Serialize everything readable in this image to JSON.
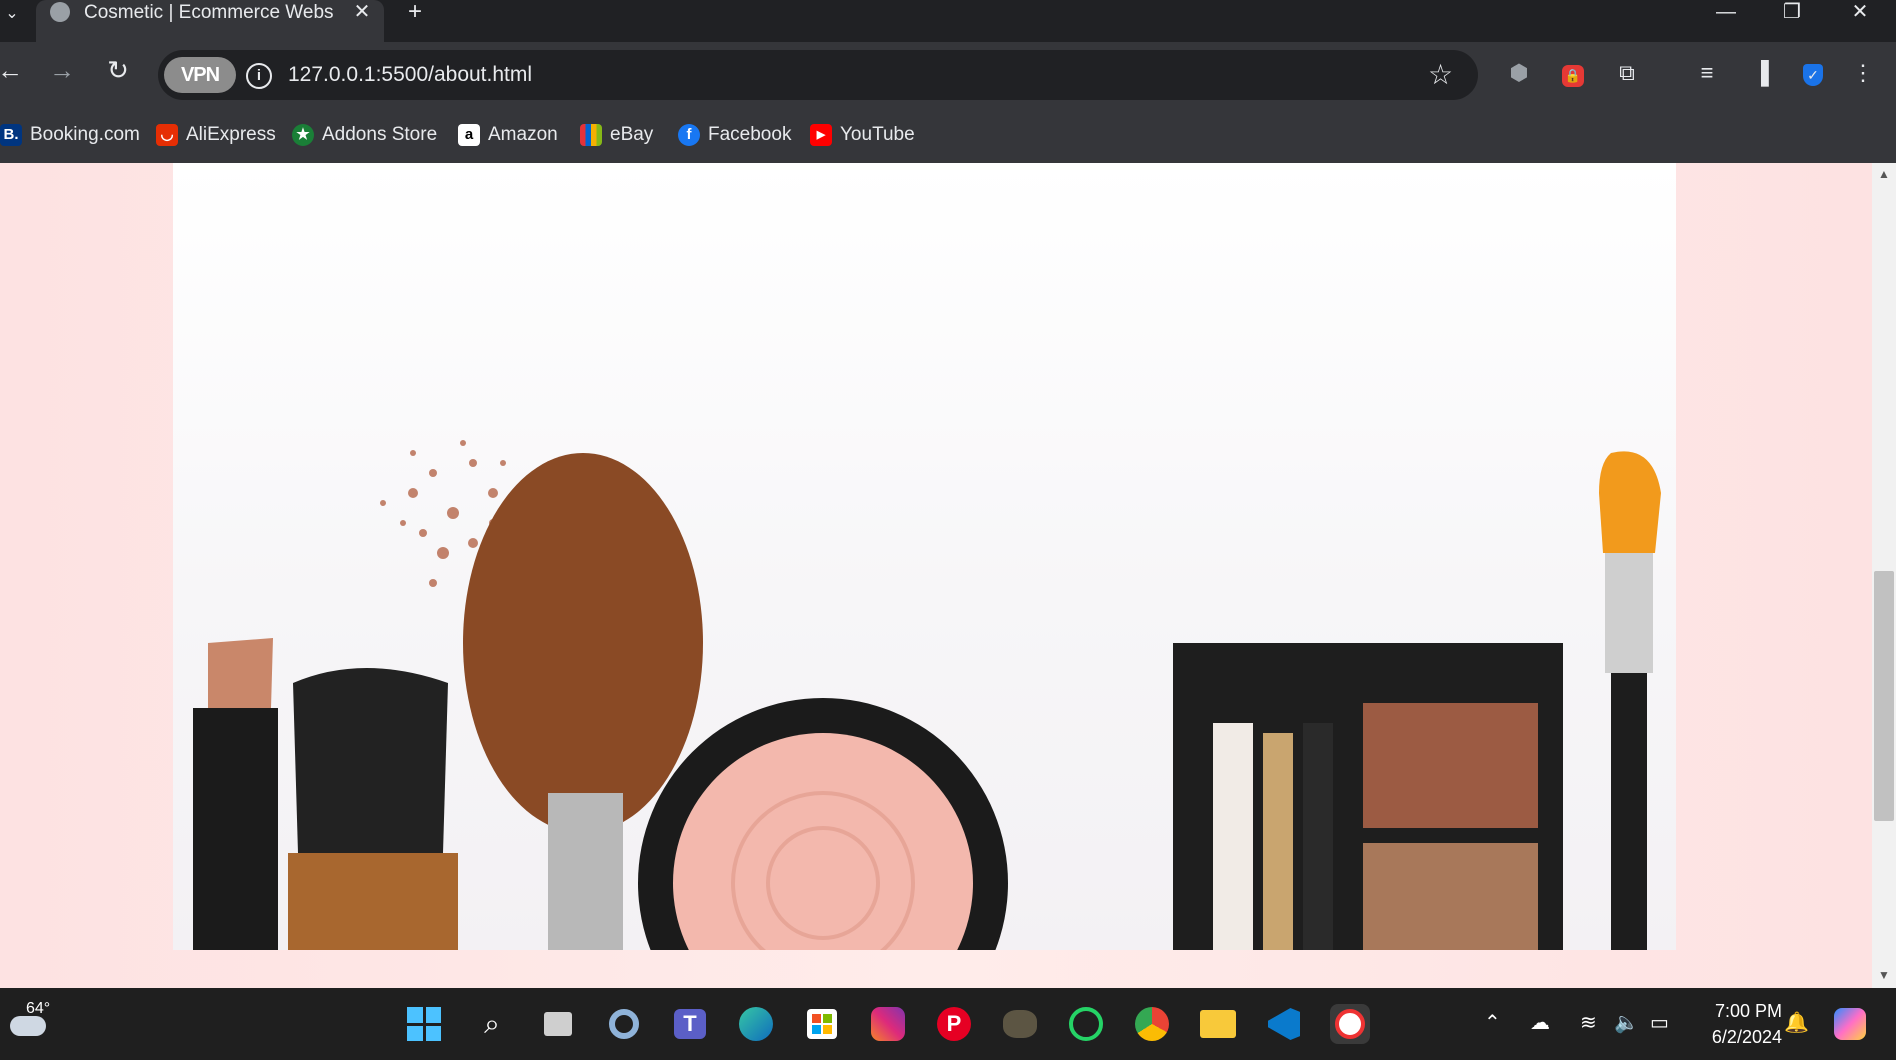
{
  "tab": {
    "title": "Cosmetic | Ecommerce Website",
    "close": "✕",
    "new": "+"
  },
  "window": {
    "minimize": "—",
    "restore": "❐",
    "close": "✕"
  },
  "toolbar": {
    "back": "←",
    "forward": "→",
    "reload": "↻",
    "vpn_label": "VPN",
    "info": "i",
    "url": "127.0.0.1:5500/about.html",
    "star": "☆"
  },
  "extensions": [
    "shield-check-extension",
    "adblock-extension",
    "puzzle-extension",
    "media-control",
    "side-panel",
    "bitwarden-extension",
    "menu"
  ],
  "bookmarks": [
    {
      "label": "Booking.com",
      "icon": "B.",
      "color": "#003580"
    },
    {
      "label": "AliExpress",
      "icon": "◡",
      "color": "#e62e04"
    },
    {
      "label": "Addons Store",
      "icon": "★",
      "color": "#1a7f37"
    },
    {
      "label": "Amazon",
      "icon": "a",
      "color": "#ffffff"
    },
    {
      "label": "eBay",
      "icon": "▦",
      "color": "#f5af02"
    },
    {
      "label": "Facebook",
      "icon": "f",
      "color": "#1877f2"
    },
    {
      "label": "YouTube",
      "icon": "▶",
      "color": "#ff0000"
    }
  ],
  "taskbar": {
    "weather_temp": "64°",
    "apps": [
      "windows-start",
      "search",
      "task-view",
      "settings",
      "teams",
      "edge",
      "store",
      "instagram",
      "pinterest",
      "gimp",
      "whatsapp",
      "chrome",
      "file-explorer",
      "vscode",
      "brave-vpn"
    ],
    "time": "7:00 PM",
    "date": "6/2/2024"
  },
  "colors": {
    "page_bg": "#fde2e2",
    "chrome_dark": "#202124",
    "chrome_mid": "#35363a"
  }
}
